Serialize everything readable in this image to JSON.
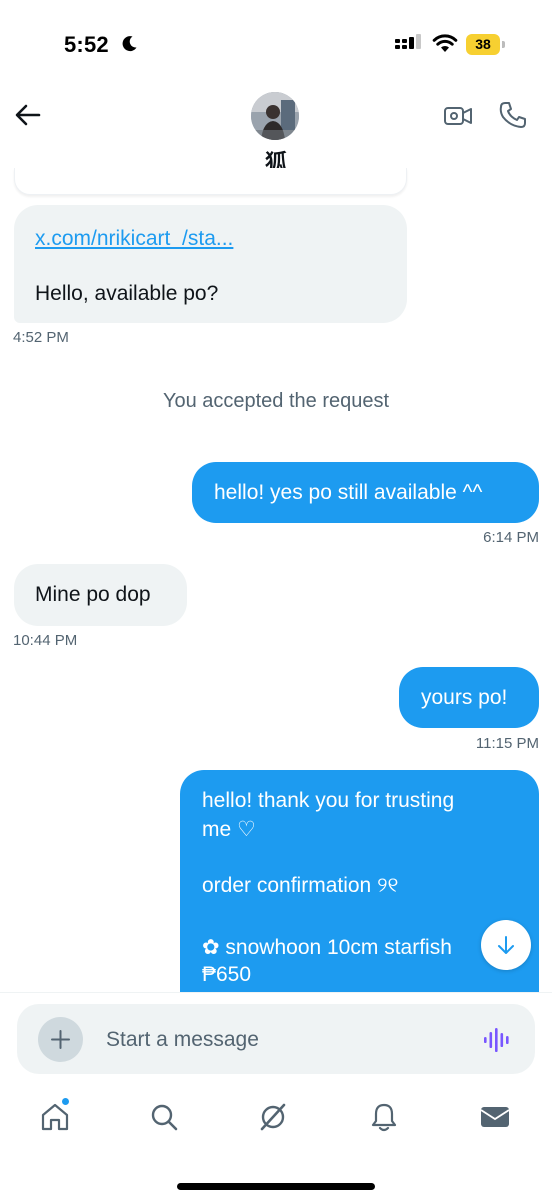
{
  "status_bar": {
    "time": "5:52",
    "battery_level": "38"
  },
  "header": {
    "contact_name": "狐"
  },
  "messages": {
    "link_text": "x.com/nrikicart_/sta...",
    "link_message": "Hello, available po?",
    "link_time": "4:52 PM",
    "system_notice": "You accepted the request",
    "out_1": "hello! yes po still available ^^",
    "out_1_time": "6:14 PM",
    "in_2": "Mine po dop",
    "in_2_time": "10:44 PM",
    "out_2": "yours po!",
    "out_2_time": "11:15 PM",
    "out_3_lines": [
      "hello! thank you for  trusting",
      "me ♡",
      "order confirmation ୨୧",
      "✿ snowhoon 10cm starfish",
      "₱650"
    ]
  },
  "composer": {
    "placeholder": "Start a message"
  },
  "nav": {
    "items": [
      "home-icon",
      "search-icon",
      "grok-icon",
      "notifications-icon",
      "messages-icon"
    ]
  },
  "colors": {
    "accent": "#1d9bf0",
    "incoming_bubble": "#eff3f4",
    "secondary_text": "#536471",
    "battery": "#f7d031",
    "voice_icon": "#7856ff"
  }
}
